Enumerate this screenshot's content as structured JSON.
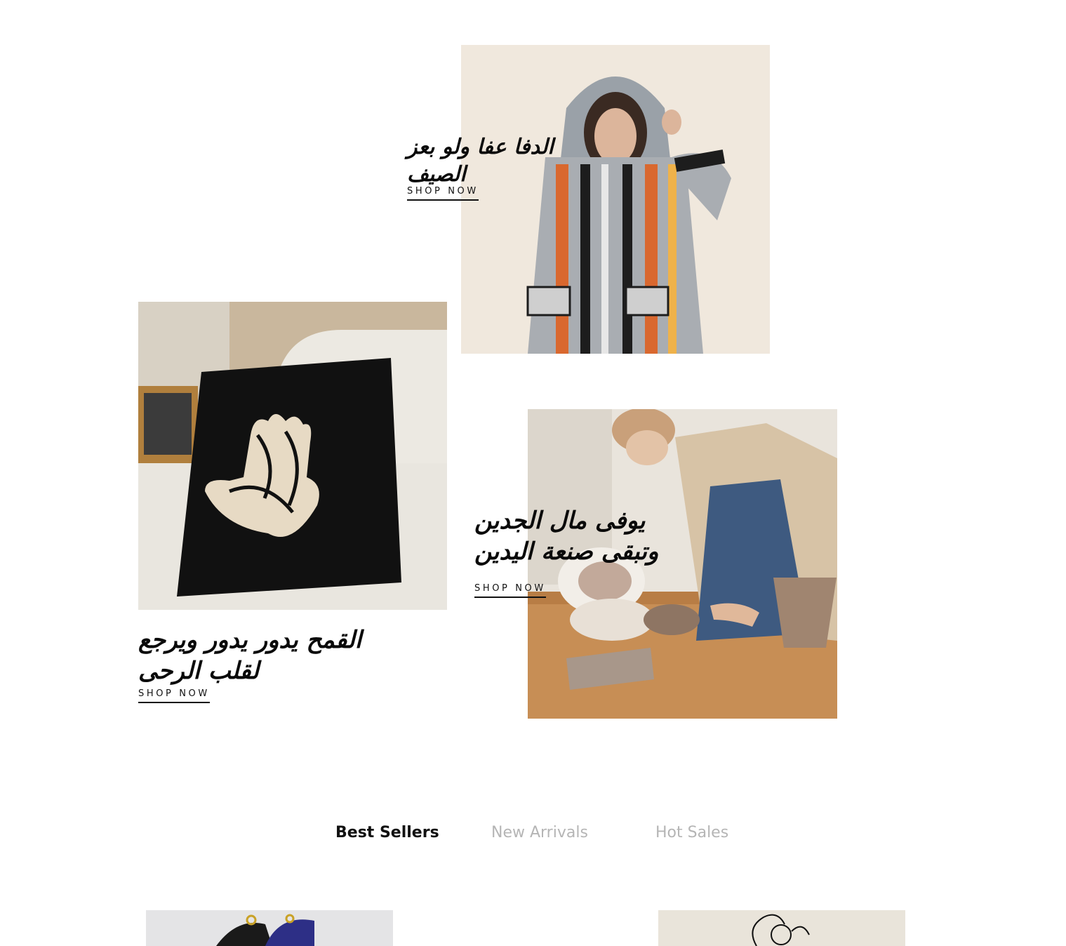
{
  "banners": [
    {
      "heading": "الدفا عفا ولو بعز الصيف",
      "cta": "SHOP NOW",
      "image": "Person wearing a striped hooded jacket"
    },
    {
      "heading": "القمح يدور يدور ويرجع لقلب الرحى",
      "cta": "SHOP NOW",
      "image": "Black cushion with a hamsa design"
    },
    {
      "heading": "يوفى مال الجدين وتبقى صنعة اليدين",
      "cta": "SHOP NOW",
      "image": "Person shaping clay pottery"
    }
  ],
  "tabs": [
    {
      "label": "Best Sellers",
      "active": true
    },
    {
      "label": "New Arrivals",
      "active": false
    },
    {
      "label": "Hot Sales",
      "active": false
    }
  ],
  "colors": {
    "text": "#111111",
    "tab_inactive": "#b5b5b5",
    "background": "#ffffff"
  }
}
